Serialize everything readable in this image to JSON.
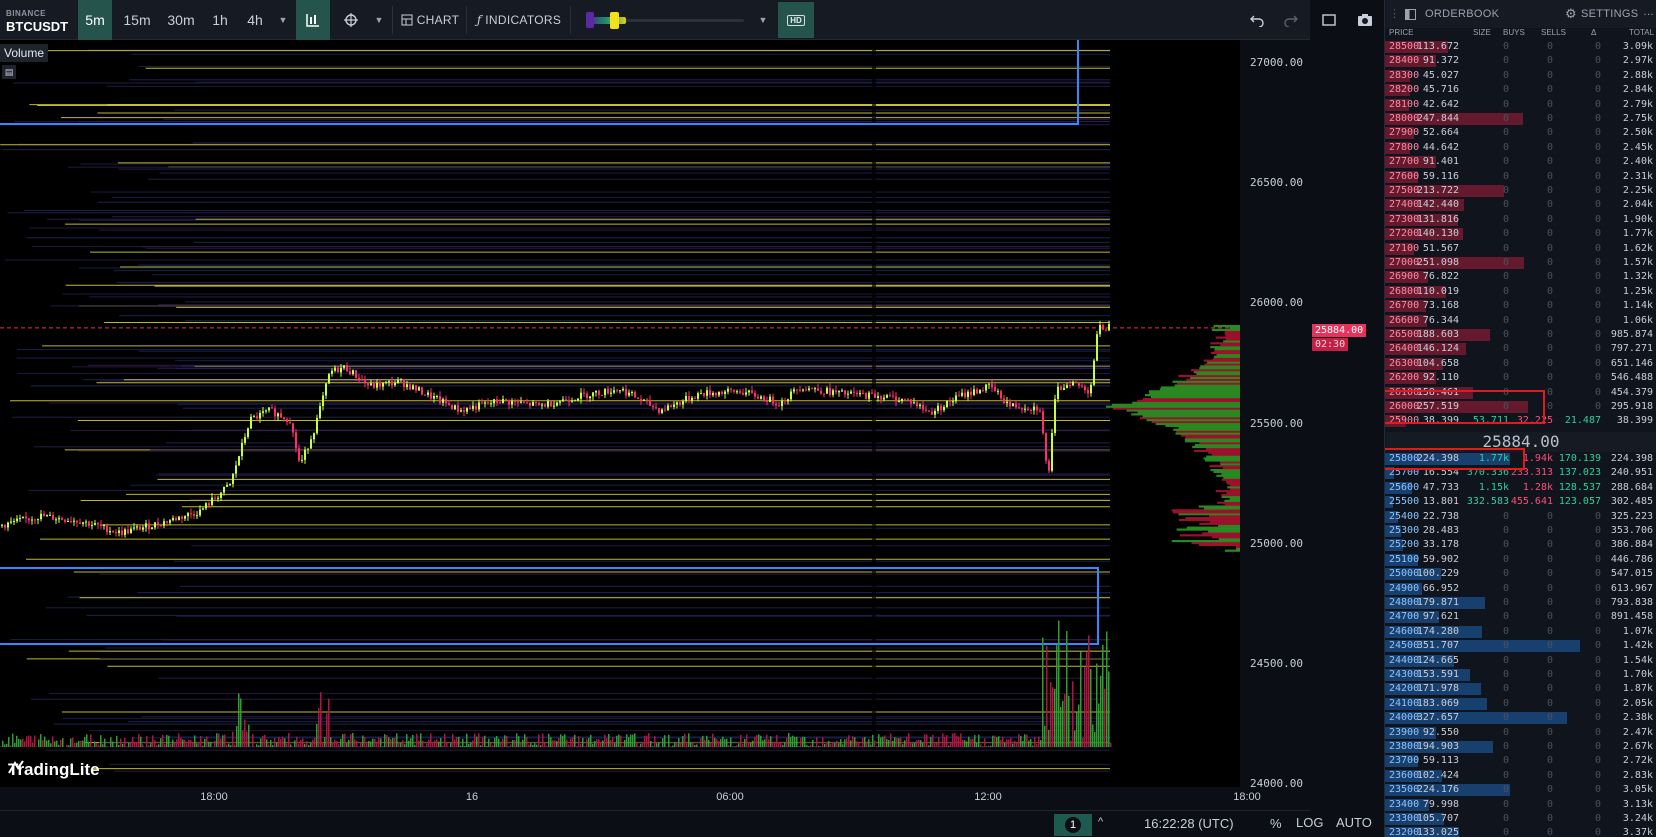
{
  "toolbar": {
    "exchange": "BINANCE",
    "symbol": "BTCUSDT",
    "timeframes": [
      "5m",
      "15m",
      "30m",
      "1h",
      "4h"
    ],
    "active_timeframe": "5m",
    "chart_label": "CHART",
    "indicators_label": "INDICATORS",
    "hd_label": "HD"
  },
  "chart": {
    "volume_label": "Volume",
    "brand": "TradingLite",
    "price_axis": [
      "27000.00",
      "26500.00",
      "26000.00",
      "25500.00",
      "25000.00",
      "24500.00",
      "24000.00"
    ],
    "current_price": "25884.00",
    "countdown": "02:30",
    "time_axis": [
      "18:00",
      "16",
      "06:00",
      "12:00",
      "18:00"
    ]
  },
  "statusbar": {
    "pane_count": "1",
    "clock": "16:22:28 (UTC)",
    "percent": "%",
    "log": "LOG",
    "auto": "AUTO"
  },
  "orderbook": {
    "title": "ORDERBOOK",
    "settings": "SETTINGS",
    "columns": [
      "PRICE",
      "SIZE",
      "BUYS",
      "SELLS",
      "Δ",
      "TOTAL"
    ],
    "mid_price": "25884.00",
    "asks": [
      [
        "28500",
        "113.672",
        "0",
        "0",
        "0",
        "3.09k"
      ],
      [
        "28400",
        "91.372",
        "0",
        "0",
        "0",
        "2.97k"
      ],
      [
        "28300",
        "45.027",
        "0",
        "0",
        "0",
        "2.88k"
      ],
      [
        "28200",
        "45.716",
        "0",
        "0",
        "0",
        "2.84k"
      ],
      [
        "28100",
        "42.642",
        "0",
        "0",
        "0",
        "2.79k"
      ],
      [
        "28000",
        "247.844",
        "0",
        "0",
        "0",
        "2.75k"
      ],
      [
        "27900",
        "52.664",
        "0",
        "0",
        "0",
        "2.50k"
      ],
      [
        "27800",
        "44.642",
        "0",
        "0",
        "0",
        "2.45k"
      ],
      [
        "27700",
        "91.401",
        "0",
        "0",
        "0",
        "2.40k"
      ],
      [
        "27600",
        "59.116",
        "0",
        "0",
        "0",
        "2.31k"
      ],
      [
        "27500",
        "213.722",
        "0",
        "0",
        "0",
        "2.25k"
      ],
      [
        "27400",
        "142.440",
        "0",
        "0",
        "0",
        "2.04k"
      ],
      [
        "27300",
        "131.816",
        "0",
        "0",
        "0",
        "1.90k"
      ],
      [
        "27200",
        "140.130",
        "0",
        "0",
        "0",
        "1.77k"
      ],
      [
        "27100",
        "51.567",
        "0",
        "0",
        "0",
        "1.62k"
      ],
      [
        "27000",
        "251.098",
        "0",
        "0",
        "0",
        "1.57k"
      ],
      [
        "26900",
        "76.822",
        "0",
        "0",
        "0",
        "1.32k"
      ],
      [
        "26800",
        "110.019",
        "0",
        "0",
        "0",
        "1.25k"
      ],
      [
        "26700",
        "73.168",
        "0",
        "0",
        "0",
        "1.14k"
      ],
      [
        "26600",
        "76.344",
        "0",
        "0",
        "0",
        "1.06k"
      ],
      [
        "26500",
        "188.603",
        "0",
        "0",
        "0",
        "985.874"
      ],
      [
        "26400",
        "146.124",
        "0",
        "0",
        "0",
        "797.271"
      ],
      [
        "26300",
        "104.658",
        "0",
        "0",
        "0",
        "651.146"
      ],
      [
        "26200",
        "92.110",
        "0",
        "0",
        "0",
        "546.488"
      ],
      [
        "26100",
        "158.461",
        "0",
        "0",
        "0",
        "454.379"
      ],
      [
        "26000",
        "257.519",
        "0",
        "0",
        "0",
        "295.918"
      ],
      [
        "25900",
        "38.399",
        "53.711",
        "32.225",
        "21.487",
        "38.399"
      ]
    ],
    "bids": [
      [
        "25800",
        "224.398",
        "1.77k",
        "1.94k",
        "170.139",
        "224.398"
      ],
      [
        "25700",
        "16.554",
        "370.336",
        "233.313",
        "137.023",
        "240.951"
      ],
      [
        "25600",
        "47.733",
        "1.15k",
        "1.28k",
        "128.537",
        "288.684"
      ],
      [
        "25500",
        "13.801",
        "332.583",
        "455.641",
        "123.057",
        "302.485"
      ],
      [
        "25400",
        "22.738",
        "0",
        "0",
        "0",
        "325.223"
      ],
      [
        "25300",
        "28.483",
        "0",
        "0",
        "0",
        "353.706"
      ],
      [
        "25200",
        "33.178",
        "0",
        "0",
        "0",
        "386.884"
      ],
      [
        "25100",
        "59.902",
        "0",
        "0",
        "0",
        "446.786"
      ],
      [
        "25000",
        "100.229",
        "0",
        "0",
        "0",
        "547.015"
      ],
      [
        "24900",
        "66.952",
        "0",
        "0",
        "0",
        "613.967"
      ],
      [
        "24800",
        "179.871",
        "0",
        "0",
        "0",
        "793.838"
      ],
      [
        "24700",
        "97.621",
        "0",
        "0",
        "0",
        "891.458"
      ],
      [
        "24600",
        "174.280",
        "0",
        "0",
        "0",
        "1.07k"
      ],
      [
        "24500",
        "351.707",
        "0",
        "0",
        "0",
        "1.42k"
      ],
      [
        "24400",
        "124.665",
        "0",
        "0",
        "0",
        "1.54k"
      ],
      [
        "24300",
        "153.591",
        "0",
        "0",
        "0",
        "1.70k"
      ],
      [
        "24200",
        "171.978",
        "0",
        "0",
        "0",
        "1.87k"
      ],
      [
        "24100",
        "183.069",
        "0",
        "0",
        "0",
        "2.05k"
      ],
      [
        "24000",
        "327.657",
        "0",
        "0",
        "0",
        "2.38k"
      ],
      [
        "23900",
        "92.550",
        "0",
        "0",
        "0",
        "2.47k"
      ],
      [
        "23800",
        "194.903",
        "0",
        "0",
        "0",
        "2.67k"
      ],
      [
        "23700",
        "59.113",
        "0",
        "0",
        "0",
        "2.72k"
      ],
      [
        "23600",
        "102.424",
        "0",
        "0",
        "0",
        "2.83k"
      ],
      [
        "23500",
        "224.176",
        "0",
        "0",
        "0",
        "3.05k"
      ],
      [
        "23400",
        "79.998",
        "0",
        "0",
        "0",
        "3.13k"
      ],
      [
        "23300",
        "105.707",
        "0",
        "0",
        "0",
        "3.24k"
      ],
      [
        "23200",
        "133.025",
        "0",
        "0",
        "0",
        "3.37k"
      ]
    ]
  },
  "colors": {
    "ask": "#e7335b",
    "bid": "#1e90ff",
    "accent": "#24544c",
    "candle_up": "#c8ff3c",
    "candle_down": "#ff2d6f",
    "highlight": "#e01b1b"
  }
}
